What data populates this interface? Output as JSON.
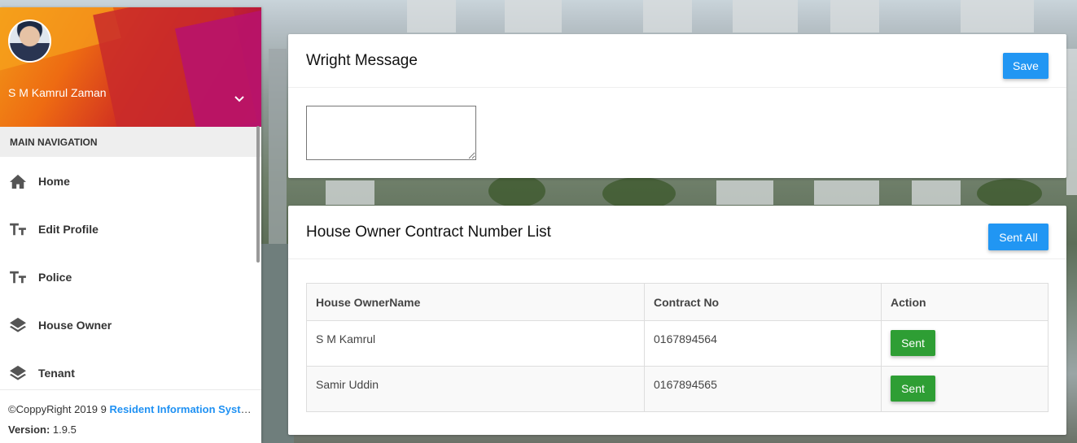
{
  "sidebar": {
    "user_name": "S M Kamrul Zaman",
    "nav_header": "MAIN NAVIGATION",
    "items": [
      {
        "label": "Home",
        "icon": "home-icon"
      },
      {
        "label": "Edit Profile",
        "icon": "text-fields-icon"
      },
      {
        "label": "Police",
        "icon": "text-fields-icon"
      },
      {
        "label": "House Owner",
        "icon": "layers-icon"
      },
      {
        "label": "Tenant",
        "icon": "layers-icon"
      }
    ],
    "footer": {
      "copyright_prefix": "©CoppyRight 2019 9 ",
      "copyright_link": "Resident Information System",
      "version_label": "Version:",
      "version_value": "1.9.5"
    }
  },
  "message_card": {
    "title": "Wright Message",
    "save_label": "Save",
    "textarea_value": ""
  },
  "list_card": {
    "title": "House Owner Contract Number List",
    "sent_all_label": "Sent All",
    "columns": [
      "House OwnerName",
      "Contract No",
      "Action"
    ],
    "rows": [
      {
        "name": "S M Kamrul",
        "contract": "0167894564",
        "action": "Sent"
      },
      {
        "name": "Samir Uddin",
        "contract": "0167894565",
        "action": "Sent"
      }
    ]
  },
  "colors": {
    "primary": "#2196f3",
    "success": "#2e9e34",
    "link": "#1f91f3"
  }
}
